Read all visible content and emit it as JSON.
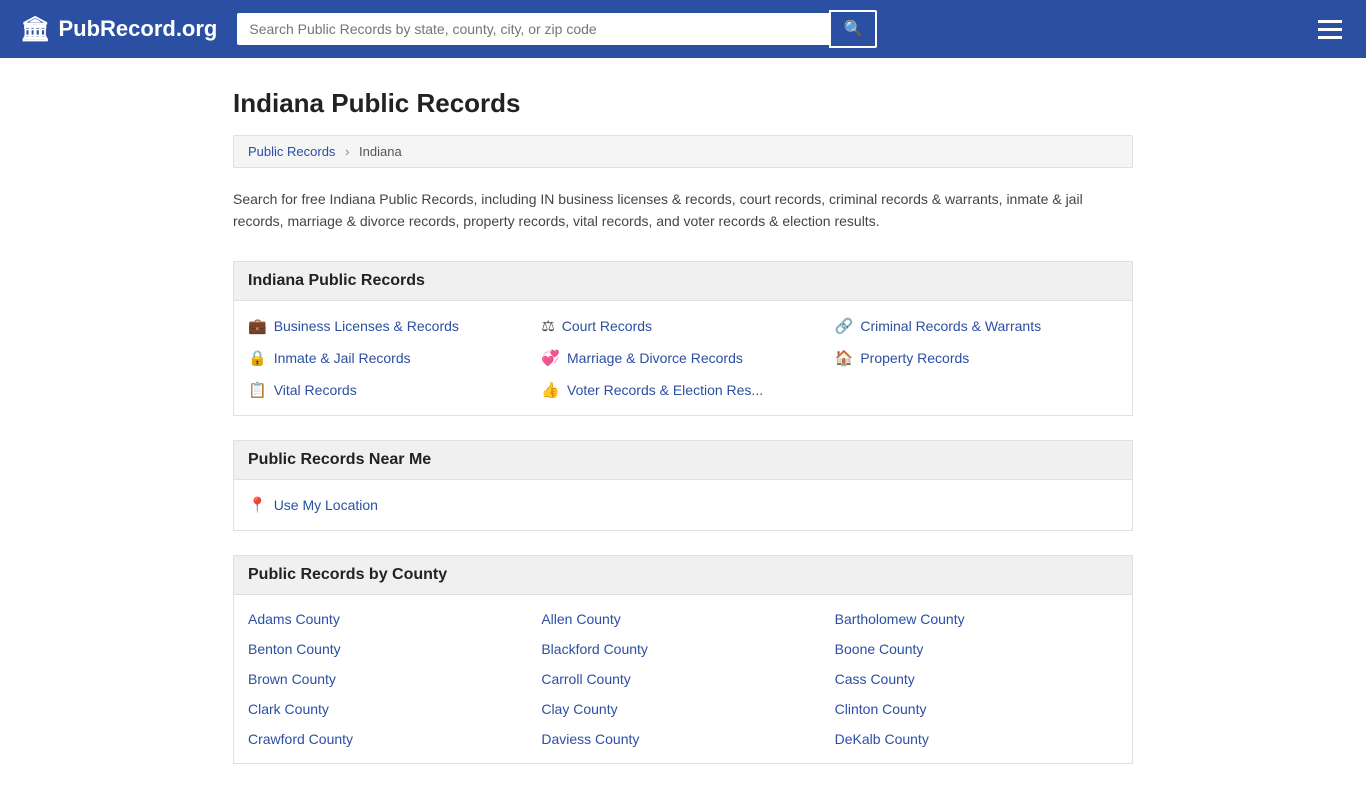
{
  "header": {
    "logo_icon": "🏛",
    "logo_text": "PubRecord.org",
    "search_placeholder": "Search Public Records by state, county, city, or zip code",
    "search_button_icon": "🔍"
  },
  "page": {
    "title": "Indiana Public Records",
    "breadcrumb": {
      "root": "Public Records",
      "current": "Indiana"
    },
    "description": "Search for free Indiana Public Records, including IN business licenses & records, court records, criminal records & warrants, inmate & jail records, marriage & divorce records, property records, vital records, and voter records & election results."
  },
  "records_section": {
    "title": "Indiana Public Records",
    "items": [
      {
        "icon": "💼",
        "label": "Business Licenses & Records"
      },
      {
        "icon": "⚖",
        "label": "Court Records"
      },
      {
        "icon": "🔗",
        "label": "Criminal Records & Warrants"
      },
      {
        "icon": "🔒",
        "label": "Inmate & Jail Records"
      },
      {
        "icon": "💞",
        "label": "Marriage & Divorce Records"
      },
      {
        "icon": "🏠",
        "label": "Property Records"
      },
      {
        "icon": "📋",
        "label": "Vital Records"
      },
      {
        "icon": "👍",
        "label": "Voter Records & Election Res..."
      }
    ]
  },
  "near_me_section": {
    "title": "Public Records Near Me",
    "use_location_label": "Use My Location"
  },
  "county_section": {
    "title": "Public Records by County",
    "counties": [
      "Adams County",
      "Allen County",
      "Bartholomew County",
      "Benton County",
      "Blackford County",
      "Boone County",
      "Brown County",
      "Carroll County",
      "Cass County",
      "Clark County",
      "Clay County",
      "Clinton County",
      "Crawford County",
      "Daviess County",
      "DeKalb County"
    ]
  }
}
